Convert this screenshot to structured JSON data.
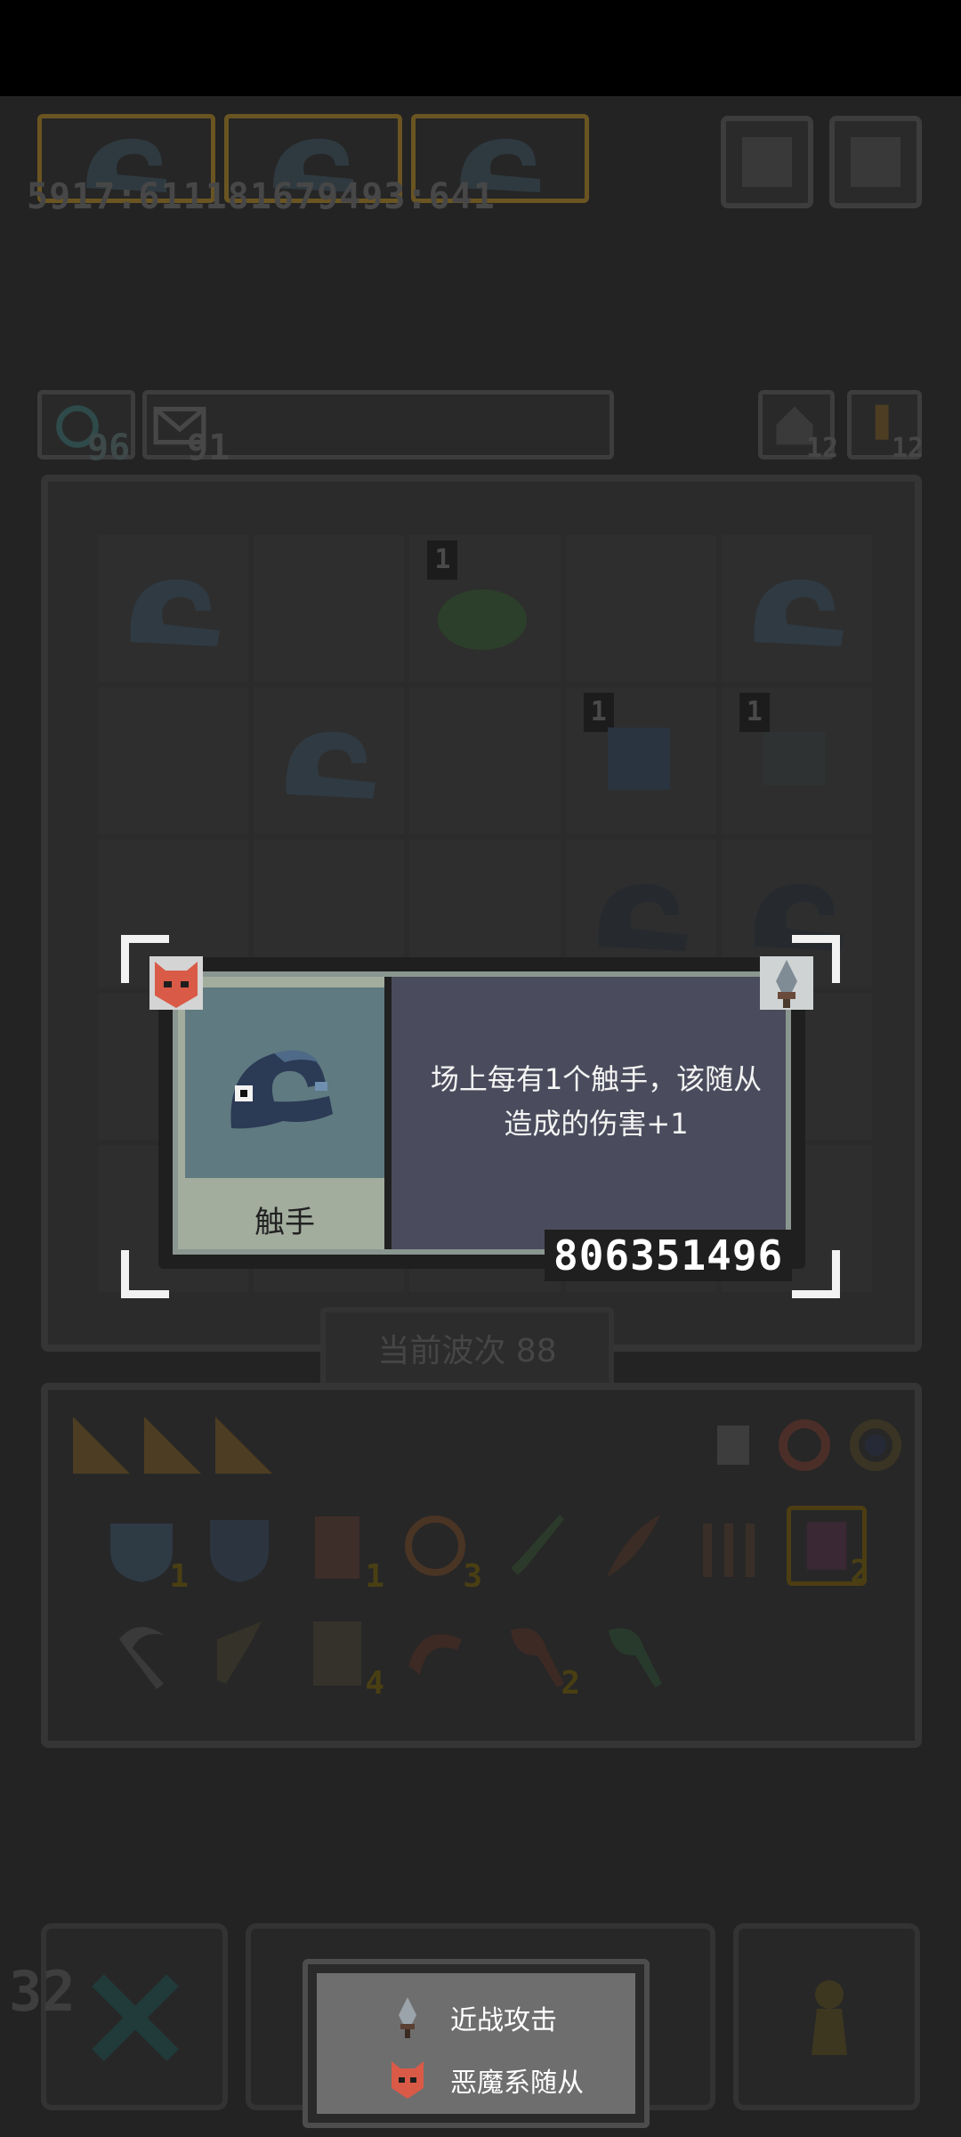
{
  "header": {
    "top_numbers": "5917:611181679493:641"
  },
  "chips": {
    "left_a": "96",
    "left_b": "91",
    "right_a": "12",
    "right_b": "12"
  },
  "board": {
    "cells": [
      {
        "monster": "tentacle-icon",
        "level": ""
      },
      {
        "monster": "",
        "level": ""
      },
      {
        "monster": "slime-icon",
        "level": "1"
      },
      {
        "monster": "",
        "level": ""
      },
      {
        "monster": "tentacle-icon",
        "level": ""
      },
      {
        "monster": "",
        "level": ""
      },
      {
        "monster": "tentacle-icon",
        "level": ""
      },
      {
        "monster": "",
        "level": ""
      },
      {
        "monster": "spirit-icon",
        "level": "1"
      },
      {
        "monster": "spider-icon",
        "level": "1"
      },
      {
        "monster": "",
        "level": ""
      },
      {
        "monster": "",
        "level": ""
      },
      {
        "monster": "",
        "level": ""
      },
      {
        "monster": "tentacle-icon",
        "level": ""
      },
      {
        "monster": "tentacle-icon",
        "level": ""
      }
    ],
    "wave_label": "当前波次 88"
  },
  "inventory": {
    "row1": [
      {
        "icon": "heart-shield-icon",
        "count": "1"
      },
      {
        "icon": "shield-icon",
        "count": ""
      },
      {
        "icon": "barrel-icon",
        "count": "1"
      },
      {
        "icon": "ring-icon",
        "count": "3"
      },
      {
        "icon": "sword-icon",
        "count": ""
      },
      {
        "icon": "feather-icon",
        "count": ""
      },
      {
        "icon": "trident-icon",
        "count": ""
      },
      {
        "icon": "scroll-icon",
        "count": "2"
      }
    ],
    "row2": [
      {
        "icon": "sickle-icon",
        "count": ""
      },
      {
        "icon": "slingshot-icon",
        "count": ""
      },
      {
        "icon": "map-icon",
        "count": "4"
      },
      {
        "icon": "boomerang-icon",
        "count": ""
      },
      {
        "icon": "axe-icon",
        "count": "2"
      },
      {
        "icon": "green-axe-icon",
        "count": ""
      }
    ]
  },
  "popup": {
    "unit_name": "触手",
    "description_line1": "场上每有1个触手，该随从",
    "description_line2": "造成的伤害+1",
    "serial": "806351496",
    "faction_badge": "demon-mask-icon",
    "attack_badge": "melee-sword-icon"
  },
  "legend": {
    "items": [
      {
        "icon": "melee-sword-icon",
        "label": "近战攻击"
      },
      {
        "icon": "demon-mask-icon",
        "label": "恶魔系随从"
      }
    ]
  },
  "footer": {
    "counter": "32"
  },
  "colors": {
    "accent_gold": "#6a5522",
    "demon_red": "#d95a47",
    "panel_bg": "#4a4b5c",
    "portrait_bg": "#5f7a80"
  }
}
